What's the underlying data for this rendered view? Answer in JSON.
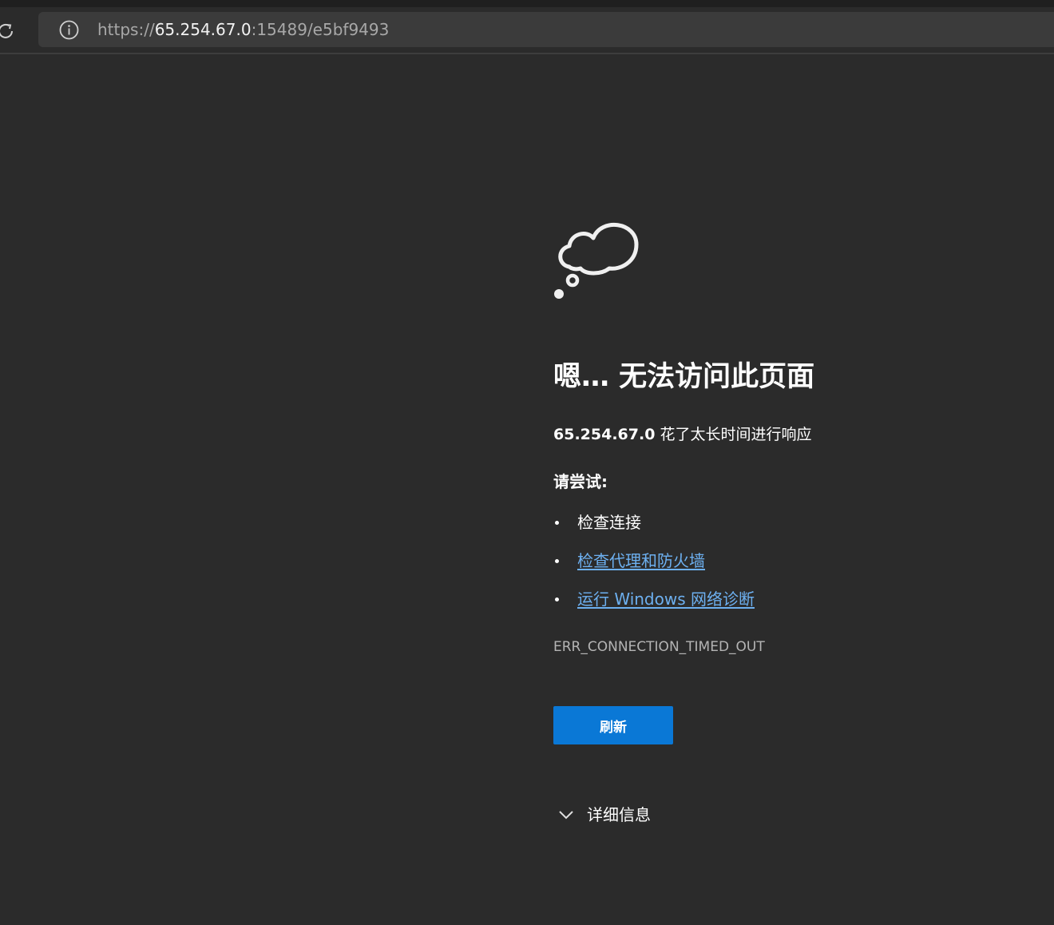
{
  "browser": {
    "url_scheme": "https://",
    "url_host": "65.254.67.0",
    "url_rest": ":15489/e5bf9493"
  },
  "error_page": {
    "title": "嗯… 无法访问此页面",
    "host": "65.254.67.0",
    "message": "花了太长时间进行响应",
    "try_heading": "请尝试:",
    "suggestions": [
      {
        "label": "检查连接",
        "link": false
      },
      {
        "label": "检查代理和防火墙",
        "link": true
      },
      {
        "label": "运行 Windows 网络诊断",
        "link": true
      }
    ],
    "error_code": "ERR_CONNECTION_TIMED_OUT",
    "refresh_label": "刷新",
    "details_label": "详细信息"
  },
  "colors": {
    "background": "#2b2b2b",
    "link": "#6db0f0",
    "button": "#0a78d6"
  }
}
